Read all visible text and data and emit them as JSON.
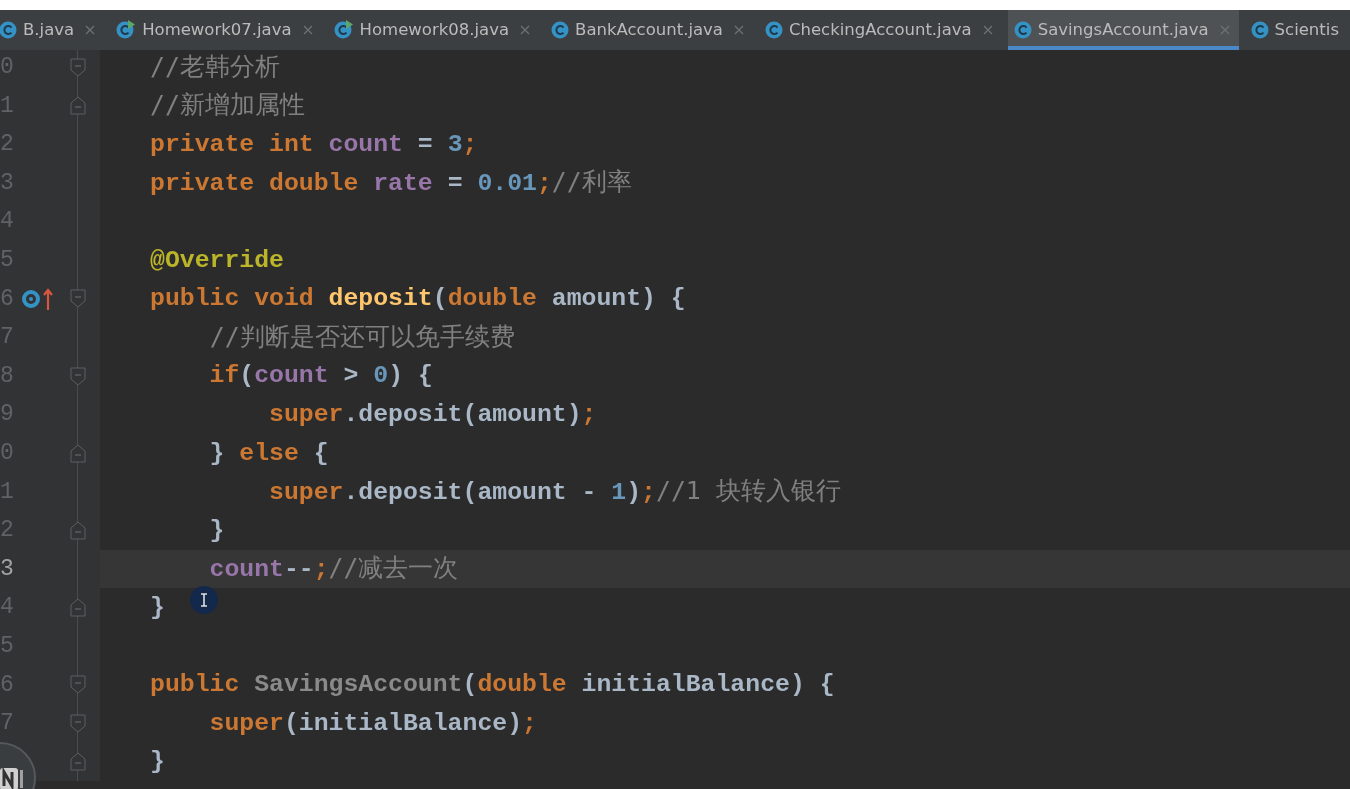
{
  "tabs": [
    {
      "label": "B.java",
      "kind": "class",
      "selected": false,
      "closable": true
    },
    {
      "label": "Homework07.java",
      "kind": "runnable",
      "selected": false,
      "closable": true
    },
    {
      "label": "Homework08.java",
      "kind": "runnable",
      "selected": false,
      "closable": true
    },
    {
      "label": "BankAccount.java",
      "kind": "class",
      "selected": false,
      "closable": true
    },
    {
      "label": "CheckingAccount.java",
      "kind": "class",
      "selected": false,
      "closable": true
    },
    {
      "label": "SavingsAccount.java",
      "kind": "class",
      "selected": true,
      "closable": true
    },
    {
      "label": "Scientis",
      "kind": "class",
      "selected": false,
      "closable": false
    }
  ],
  "editor": {
    "lines": [
      {
        "number": "0",
        "markers": [
          {
            "kind": "fold-start"
          }
        ],
        "current": false,
        "tokens": [
          {
            "kind": "comment",
            "text": "//老韩分析"
          }
        ]
      },
      {
        "number": "1",
        "markers": [
          {
            "kind": "fold-end"
          }
        ],
        "current": false,
        "tokens": [
          {
            "kind": "comment",
            "text": "//新增加属性"
          }
        ]
      },
      {
        "number": "2",
        "current": false,
        "tokens": [
          {
            "kind": "keyword",
            "text": "private int "
          },
          {
            "kind": "field",
            "text": "count"
          },
          {
            "kind": "plain",
            "text": " = "
          },
          {
            "kind": "number",
            "text": "3"
          },
          {
            "kind": "keyword",
            "text": ";"
          }
        ]
      },
      {
        "number": "3",
        "current": false,
        "tokens": [
          {
            "kind": "keyword",
            "text": "private double "
          },
          {
            "kind": "field",
            "text": "rate"
          },
          {
            "kind": "plain",
            "text": " = "
          },
          {
            "kind": "number",
            "text": "0.01"
          },
          {
            "kind": "keyword",
            "text": ";"
          },
          {
            "kind": "comment",
            "text": "//利率"
          }
        ]
      },
      {
        "number": "4",
        "current": false
      },
      {
        "number": "5",
        "current": false,
        "tokens": [
          {
            "kind": "annotation",
            "text": "@Override"
          }
        ]
      },
      {
        "number": "6",
        "markers": [
          {
            "kind": "override"
          },
          {
            "kind": "fold-start"
          }
        ],
        "current": false,
        "tokens": [
          {
            "kind": "keyword",
            "text": "public void "
          },
          {
            "kind": "function",
            "text": "deposit"
          },
          {
            "kind": "plain",
            "text": "("
          },
          {
            "kind": "keyword",
            "text": "double "
          },
          {
            "kind": "plain",
            "text": "amount) {"
          }
        ]
      },
      {
        "number": "7",
        "current": false,
        "tokens": [
          {
            "kind": "comment",
            "text": "    //判断是否还可以免手续费"
          }
        ]
      },
      {
        "number": "8",
        "markers": [
          {
            "kind": "fold-start"
          }
        ],
        "current": false,
        "tokens": [
          {
            "kind": "keyword",
            "text": "    if"
          },
          {
            "kind": "plain",
            "text": "("
          },
          {
            "kind": "field",
            "text": "count"
          },
          {
            "kind": "plain",
            "text": " > "
          },
          {
            "kind": "number",
            "text": "0"
          },
          {
            "kind": "plain",
            "text": ") {"
          }
        ]
      },
      {
        "number": "9",
        "current": false,
        "tokens": [
          {
            "kind": "keyword",
            "text": "        super"
          },
          {
            "kind": "plain",
            "text": ".deposit(amount)"
          },
          {
            "kind": "keyword",
            "text": ";"
          }
        ]
      },
      {
        "number": "0",
        "markers": [
          {
            "kind": "fold-end"
          }
        ],
        "current": false,
        "tokens": [
          {
            "kind": "plain",
            "text": "    } "
          },
          {
            "kind": "keyword",
            "text": "else "
          },
          {
            "kind": "plain",
            "text": "{"
          }
        ]
      },
      {
        "number": "1",
        "current": false,
        "tokens": [
          {
            "kind": "keyword",
            "text": "        super"
          },
          {
            "kind": "plain",
            "text": ".deposit(amount - "
          },
          {
            "kind": "number",
            "text": "1"
          },
          {
            "kind": "plain",
            "text": ")"
          },
          {
            "kind": "keyword",
            "text": ";"
          },
          {
            "kind": "comment",
            "text": "//1 块转入银行"
          }
        ]
      },
      {
        "number": "2",
        "markers": [
          {
            "kind": "fold-end"
          }
        ],
        "current": false,
        "tokens": [
          {
            "kind": "plain",
            "text": "    }"
          }
        ]
      },
      {
        "number": "3",
        "current": true,
        "tokens": [
          {
            "kind": "field",
            "text": "    count"
          },
          {
            "kind": "plain",
            "text": "--"
          },
          {
            "kind": "keyword",
            "text": ";"
          },
          {
            "kind": "comment",
            "text": "//减去一次"
          }
        ]
      },
      {
        "number": "4",
        "markers": [
          {
            "kind": "fold-end"
          }
        ],
        "current": false,
        "tokens": [
          {
            "kind": "plain",
            "text": "}"
          }
        ]
      },
      {
        "number": "5",
        "current": false
      },
      {
        "number": "6",
        "markers": [
          {
            "kind": "fold-start"
          }
        ],
        "current": false,
        "tokens": [
          {
            "kind": "keyword",
            "text": "public "
          },
          {
            "kind": "unused",
            "text": "SavingsAccount"
          },
          {
            "kind": "plain",
            "text": "("
          },
          {
            "kind": "keyword",
            "text": "double "
          },
          {
            "kind": "plain",
            "text": "initialBalance) {"
          }
        ]
      },
      {
        "number": "7",
        "markers": [
          {
            "kind": "fold-start"
          }
        ],
        "current": false,
        "tokens": [
          {
            "kind": "keyword",
            "text": "    super"
          },
          {
            "kind": "plain",
            "text": "(initialBalance)"
          },
          {
            "kind": "keyword",
            "text": ";"
          }
        ]
      },
      {
        "markers": [
          {
            "kind": "fold-end"
          }
        ],
        "tokens": [
          {
            "kind": "plain",
            "text": "}"
          }
        ]
      }
    ]
  }
}
